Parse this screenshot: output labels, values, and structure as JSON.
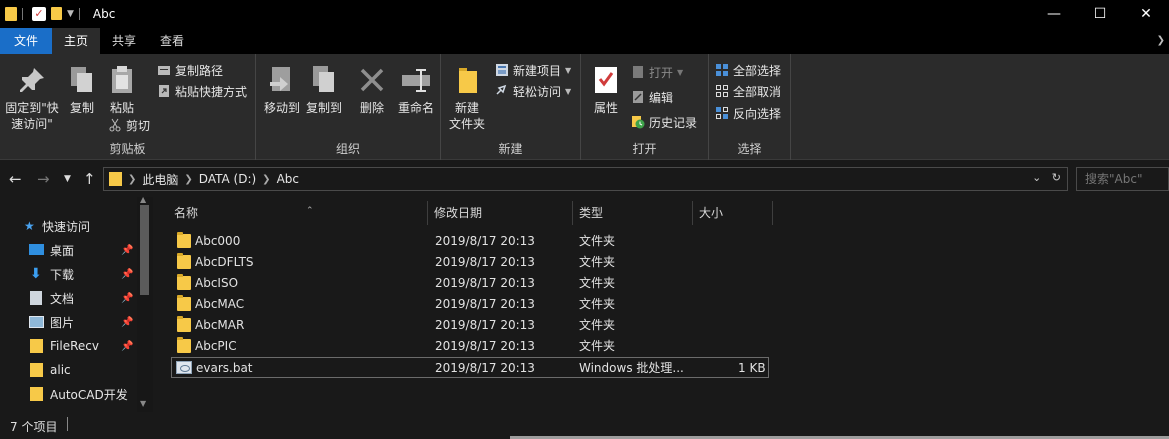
{
  "window": {
    "title": "Abc",
    "minimize": "—",
    "maximize": "☐",
    "close": "✕"
  },
  "tabs": [
    {
      "label": "文件"
    },
    {
      "label": "主页"
    },
    {
      "label": "共享"
    },
    {
      "label": "查看"
    }
  ],
  "ribbon": {
    "clipboard": {
      "label": "剪贴板",
      "pin_quick": "固定到\"快",
      "pin_quick2": "速访问\"",
      "copy": "复制",
      "paste": "粘贴",
      "copy_path": "复制路径",
      "paste_shortcut": "粘贴快捷方式",
      "cut": "剪切"
    },
    "organize": {
      "label": "组织",
      "move_to": "移动到",
      "copy_to": "复制到",
      "delete": "删除",
      "rename": "重命名"
    },
    "new": {
      "label": "新建",
      "new_folder": "新建",
      "new_folder2": "文件夹",
      "new_item": "新建项目",
      "easy_access": "轻松访问"
    },
    "open": {
      "label": "打开",
      "properties": "属性",
      "open": "打开",
      "edit": "编辑",
      "history": "历史记录"
    },
    "select": {
      "label": "选择",
      "select_all": "全部选择",
      "select_none": "全部取消",
      "invert": "反向选择"
    }
  },
  "address": {
    "crumbs": [
      "此电脑",
      "DATA (D:)",
      "Abc"
    ],
    "search_placeholder": "搜索\"Abc\""
  },
  "sidebar": {
    "items": [
      {
        "label": "快速访问"
      },
      {
        "label": "桌面"
      },
      {
        "label": "下载"
      },
      {
        "label": "文档"
      },
      {
        "label": "图片"
      },
      {
        "label": "FileRecv"
      },
      {
        "label": "alic"
      },
      {
        "label": "AutoCAD开发"
      }
    ]
  },
  "columns": {
    "name": "名称",
    "modified": "修改日期",
    "type": "类型",
    "size": "大小"
  },
  "files": [
    {
      "name": "Abc000",
      "modified": "2019/8/17 20:13",
      "type": "文件夹",
      "size": ""
    },
    {
      "name": "AbcDFLTS",
      "modified": "2019/8/17 20:13",
      "type": "文件夹",
      "size": ""
    },
    {
      "name": "AbcISO",
      "modified": "2019/8/17 20:13",
      "type": "文件夹",
      "size": ""
    },
    {
      "name": "AbcMAC",
      "modified": "2019/8/17 20:13",
      "type": "文件夹",
      "size": ""
    },
    {
      "name": "AbcMAR",
      "modified": "2019/8/17 20:13",
      "type": "文件夹",
      "size": ""
    },
    {
      "name": "AbcPIC",
      "modified": "2019/8/17 20:13",
      "type": "文件夹",
      "size": ""
    },
    {
      "name": "evars.bat",
      "modified": "2019/8/17 20:13",
      "type": "Windows 批处理...",
      "size": "1 KB"
    }
  ],
  "status": {
    "count": "7 个项目"
  },
  "colors": {
    "accent": "#1a6ec8",
    "folder": "#f7c948",
    "background": "#191919",
    "ribbon": "#2b2b2b"
  }
}
